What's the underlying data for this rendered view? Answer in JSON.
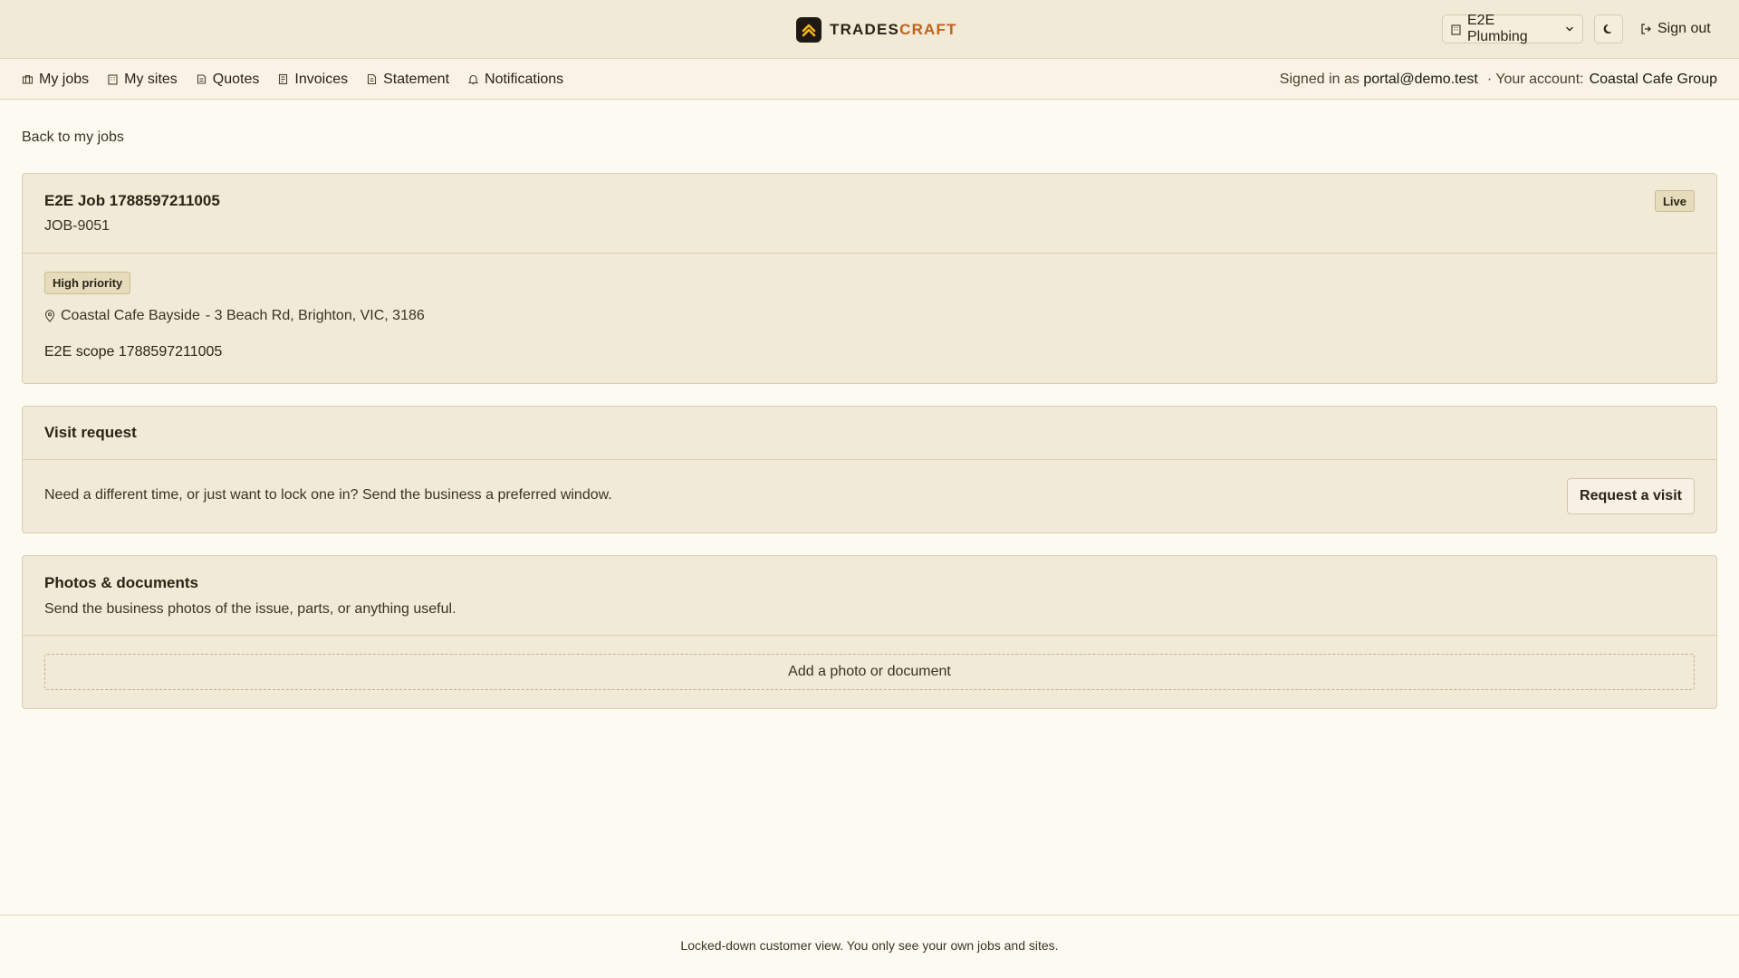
{
  "header": {
    "brand_part1": "TRADES",
    "brand_part2": "CRAFT",
    "org_selector": "E2E Plumbing",
    "sign_out": "Sign out"
  },
  "nav": {
    "items": [
      {
        "label": "My jobs",
        "icon": "briefcase-icon"
      },
      {
        "label": "My sites",
        "icon": "building-icon"
      },
      {
        "label": "Quotes",
        "icon": "quote-icon"
      },
      {
        "label": "Invoices",
        "icon": "invoice-icon"
      },
      {
        "label": "Statement",
        "icon": "document-icon"
      },
      {
        "label": "Notifications",
        "icon": "bell-icon"
      }
    ],
    "signed_in_prefix": "Signed in as",
    "signed_in_email": "portal@demo.test",
    "account_prefix": "· Your account:",
    "account_name": "Coastal Cafe Group"
  },
  "back_link": "Back to my jobs",
  "job": {
    "title": "E2E Job 1788597211005",
    "number": "JOB-9051",
    "status": "Live",
    "priority": "High priority",
    "site_name": "Coastal Cafe Bayside",
    "address": "- 3 Beach Rd, Brighton, VIC, 3186",
    "scope": "E2E scope 1788597211005"
  },
  "visit": {
    "title": "Visit request",
    "text": "Need a different time, or just want to lock one in? Send the business a preferred window.",
    "button": "Request a visit"
  },
  "photos": {
    "title": "Photos & documents",
    "subtitle": "Send the business photos of the issue, parts, or anything useful.",
    "upload": "Add a photo or document"
  },
  "footer": {
    "text": "Locked-down customer view. You only see your own jobs and sites."
  },
  "colors": {
    "background": "#fdfaf1",
    "panel": "#f1ead6",
    "brand_accent": "#c0621c",
    "logo_tile": "#1e1a13",
    "logo_mark": "#f5b21a"
  }
}
